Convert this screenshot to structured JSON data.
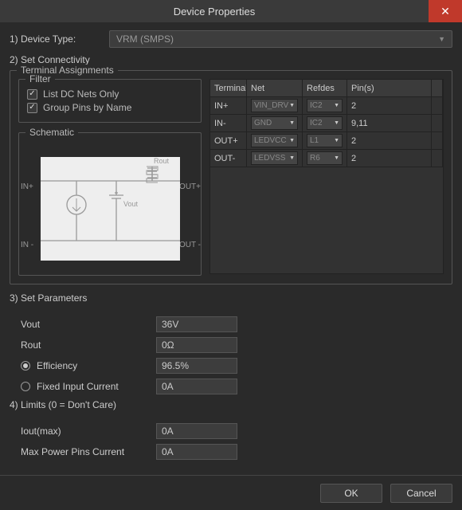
{
  "window": {
    "title": "Device Properties"
  },
  "step1": {
    "label": "1) Device Type:",
    "value": "VRM (SMPS)"
  },
  "step2": {
    "label": "2) Set Connectivity"
  },
  "terminal_assignments": {
    "legend": "Terminal Assignments",
    "filter": {
      "legend": "Filter",
      "list_dc_nets": {
        "label": "List DC Nets Only",
        "checked": true
      },
      "group_pins": {
        "label": "Group Pins by Name",
        "checked": true
      }
    },
    "schematic": {
      "legend": "Schematic",
      "labels": {
        "inp": "IN+",
        "inn": "IN -",
        "outp": "OUT+",
        "outn": "OUT -",
        "rout": "Rout",
        "vout": "Vout"
      }
    },
    "table": {
      "headers": {
        "terminal": "Terminal",
        "net": "Net",
        "refdes": "Refdes",
        "pins": "Pin(s)"
      },
      "rows": [
        {
          "terminal": "IN+",
          "net": "VIN_DRV",
          "refdes": "IC2",
          "pins": "2"
        },
        {
          "terminal": "IN-",
          "net": "GND",
          "refdes": "IC2",
          "pins": "9,11"
        },
        {
          "terminal": "OUT+",
          "net": "LEDVCC",
          "refdes": "L1",
          "pins": "2"
        },
        {
          "terminal": "OUT-",
          "net": "LEDVSS",
          "refdes": "R6",
          "pins": "2"
        }
      ]
    }
  },
  "step3": {
    "label": "3) Set Parameters",
    "vout": {
      "label": "Vout",
      "value": "36V"
    },
    "rout": {
      "label": "Rout",
      "value": "0Ω"
    },
    "efficiency": {
      "label": "Efficiency",
      "value": "96.5%",
      "selected": true
    },
    "fixed_current": {
      "label": "Fixed Input Current",
      "value": "0A",
      "selected": false
    }
  },
  "step4": {
    "label": "4) Limits (0 = Don't Care)",
    "iout_max": {
      "label": "Iout(max)",
      "value": "0A"
    },
    "max_power_pins": {
      "label": "Max Power Pins Current",
      "value": "0A"
    }
  },
  "buttons": {
    "ok": "OK",
    "cancel": "Cancel"
  }
}
